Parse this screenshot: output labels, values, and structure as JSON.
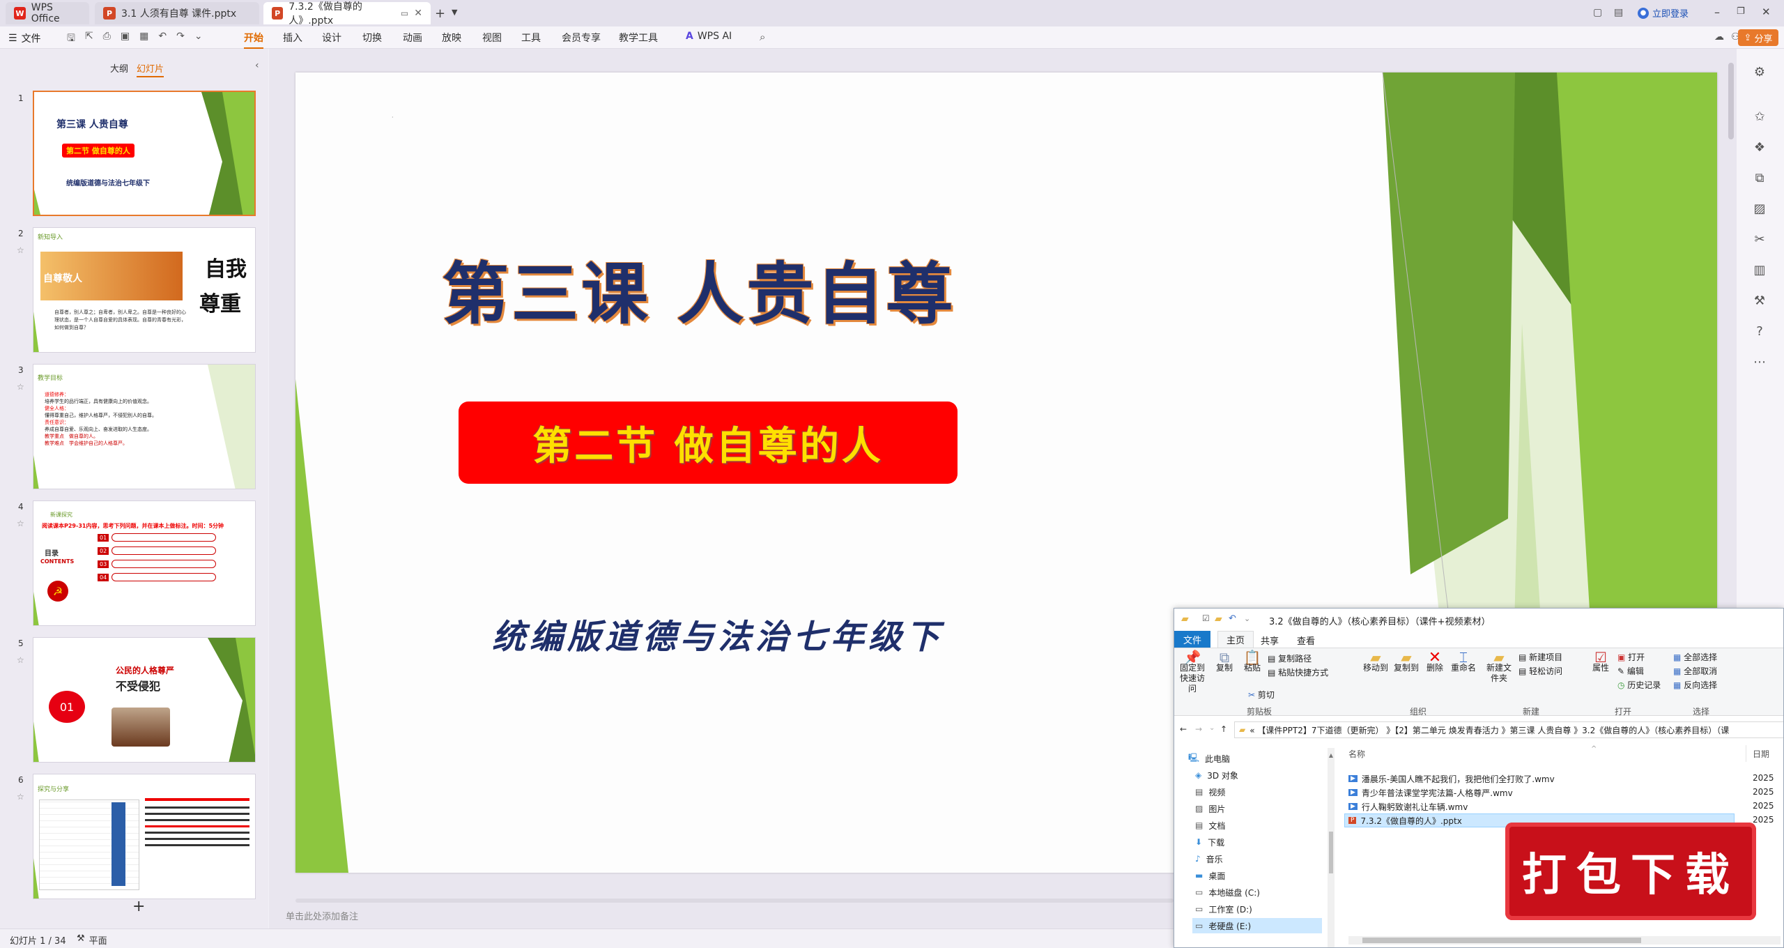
{
  "tabs": [
    {
      "label": "WPS Office",
      "icon": "wps-logo-icon"
    },
    {
      "label": "3.1 人须有自尊 课件.pptx",
      "icon": "ppt-file-icon"
    },
    {
      "label": "7.3.2《做自尊的人》.pptx",
      "icon": "ppt-file-icon"
    }
  ],
  "titlebar": {
    "login": "立即登录"
  },
  "menu": {
    "file": "文件",
    "items": [
      "开始",
      "插入",
      "设计",
      "切换",
      "动画",
      "放映",
      "视图",
      "工具",
      "会员专享",
      "教学工具"
    ],
    "active": "开始",
    "ai": "WPS AI",
    "share": "分享"
  },
  "leftpanel": {
    "tab_outline": "大纲",
    "tab_slides": "幻灯片",
    "slide_numbers": [
      "1",
      "2",
      "3",
      "4",
      "5",
      "6"
    ],
    "add": "+"
  },
  "thumbs": {
    "s1": {
      "title": "第三课 人贵自尊",
      "sub": "第二节 做自尊的人",
      "foot": "统编版道德与法治七年级下"
    },
    "s2": {
      "head": "新知导入",
      "banner": "自尊敬人",
      "big1": "自我",
      "big2": "尊重",
      "text": "自尊者，别人尊之；自卑者，别人卑之。自尊是一种良好的心理状态，是一个人自尊自爱的具体表现。自尊的青春有光彩，如何做到自尊？"
    },
    "s3": {
      "head": "教学目标",
      "l1": "道德修养：",
      "l2": "培养学生的品行端正，具有健康向上的价值观念。",
      "l3": "健全人格：",
      "l4": "懂得尊重自己，维护人格尊严，不侵犯别人的自尊。",
      "l5": "责任意识：",
      "l6": "养成自尊自爱、乐观向上、奋发进取的人生态度。",
      "l7": "教学重点　做自尊的人。",
      "l8": "教学难点　学会维护自己的人格尊严。"
    },
    "s4": {
      "head": "新课探究",
      "task": "阅读课本P29-31内容，思考下列问题，并在课本上做标注。时间：5分钟",
      "items": [
        "01",
        "02",
        "03",
        "04"
      ],
      "label": "目录",
      "label2": "CONTENTS"
    },
    "s5": {
      "title1": "公民的人格尊严",
      "title2": "不受侵犯",
      "badge": "01"
    },
    "s6": {
      "head": "探究与分享"
    }
  },
  "slide": {
    "title": "第三课  人贵自尊",
    "subtitle": "第二节  做自尊的人",
    "footer": "统编版道德与法治七年级下"
  },
  "notes_placeholder": "单击此处添加备注",
  "status": {
    "slide": "幻灯片 1 / 34",
    "theme": "平面"
  },
  "explorer": {
    "title": "3.2《做自尊的人》（核心素养目标）（课件+视频素材）",
    "tabs": [
      "文件",
      "主页",
      "共享",
      "查看"
    ],
    "ribbon": {
      "pin": "固定到快速访问",
      "copy": "复制",
      "paste": "粘贴",
      "copy_path": "复制路径",
      "paste_shortcut": "粘贴快捷方式",
      "cut": "剪切",
      "move_to": "移动到",
      "copy_to": "复制到",
      "delete": "删除",
      "rename": "重命名",
      "new_folder": "新建文件夹",
      "new_item": "新建项目",
      "easy_access": "轻松访问",
      "properties": "属性",
      "open": "打开",
      "edit": "编辑",
      "history": "历史记录",
      "select_all": "全部选择",
      "select_none": "全部取消",
      "invert": "反向选择",
      "groups": [
        "剪贴板",
        "组织",
        "新建",
        "打开",
        "选择"
      ]
    },
    "address": "«  【课件PPT2】7下道德（更新完） 》【2】第二单元 焕发青春活力 》第三课 人贵自尊 》3.2《做自尊的人》（核心素养目标）（课",
    "tree": [
      "此电脑",
      "3D 对象",
      "视频",
      "图片",
      "文档",
      "下载",
      "音乐",
      "桌面",
      "本地磁盘 (C:)",
      "工作室 (D:)",
      "老硬盘 (E:)"
    ],
    "col_name": "名称",
    "col_date": "日期",
    "files": [
      {
        "name": "潘晨乐-美国人瞧不起我们，我把他们全打败了.wmv",
        "date": "2025"
      },
      {
        "name": "青少年普法课堂学宪法篇-人格尊严.wmv",
        "date": "2025"
      },
      {
        "name": "行人鞠躬致谢礼让车辆.wmv",
        "date": "2025"
      },
      {
        "name": "7.3.2《做自尊的人》.pptx",
        "date": "2025"
      }
    ]
  },
  "stamp": "打包下载",
  "colors": {
    "green_dark": "#5c8f2a",
    "green_light": "#8dc63f",
    "title_blue": "#1f2f6b",
    "red": "#ff0000",
    "yellow": "#ffe000",
    "accent": "#e06a00"
  }
}
